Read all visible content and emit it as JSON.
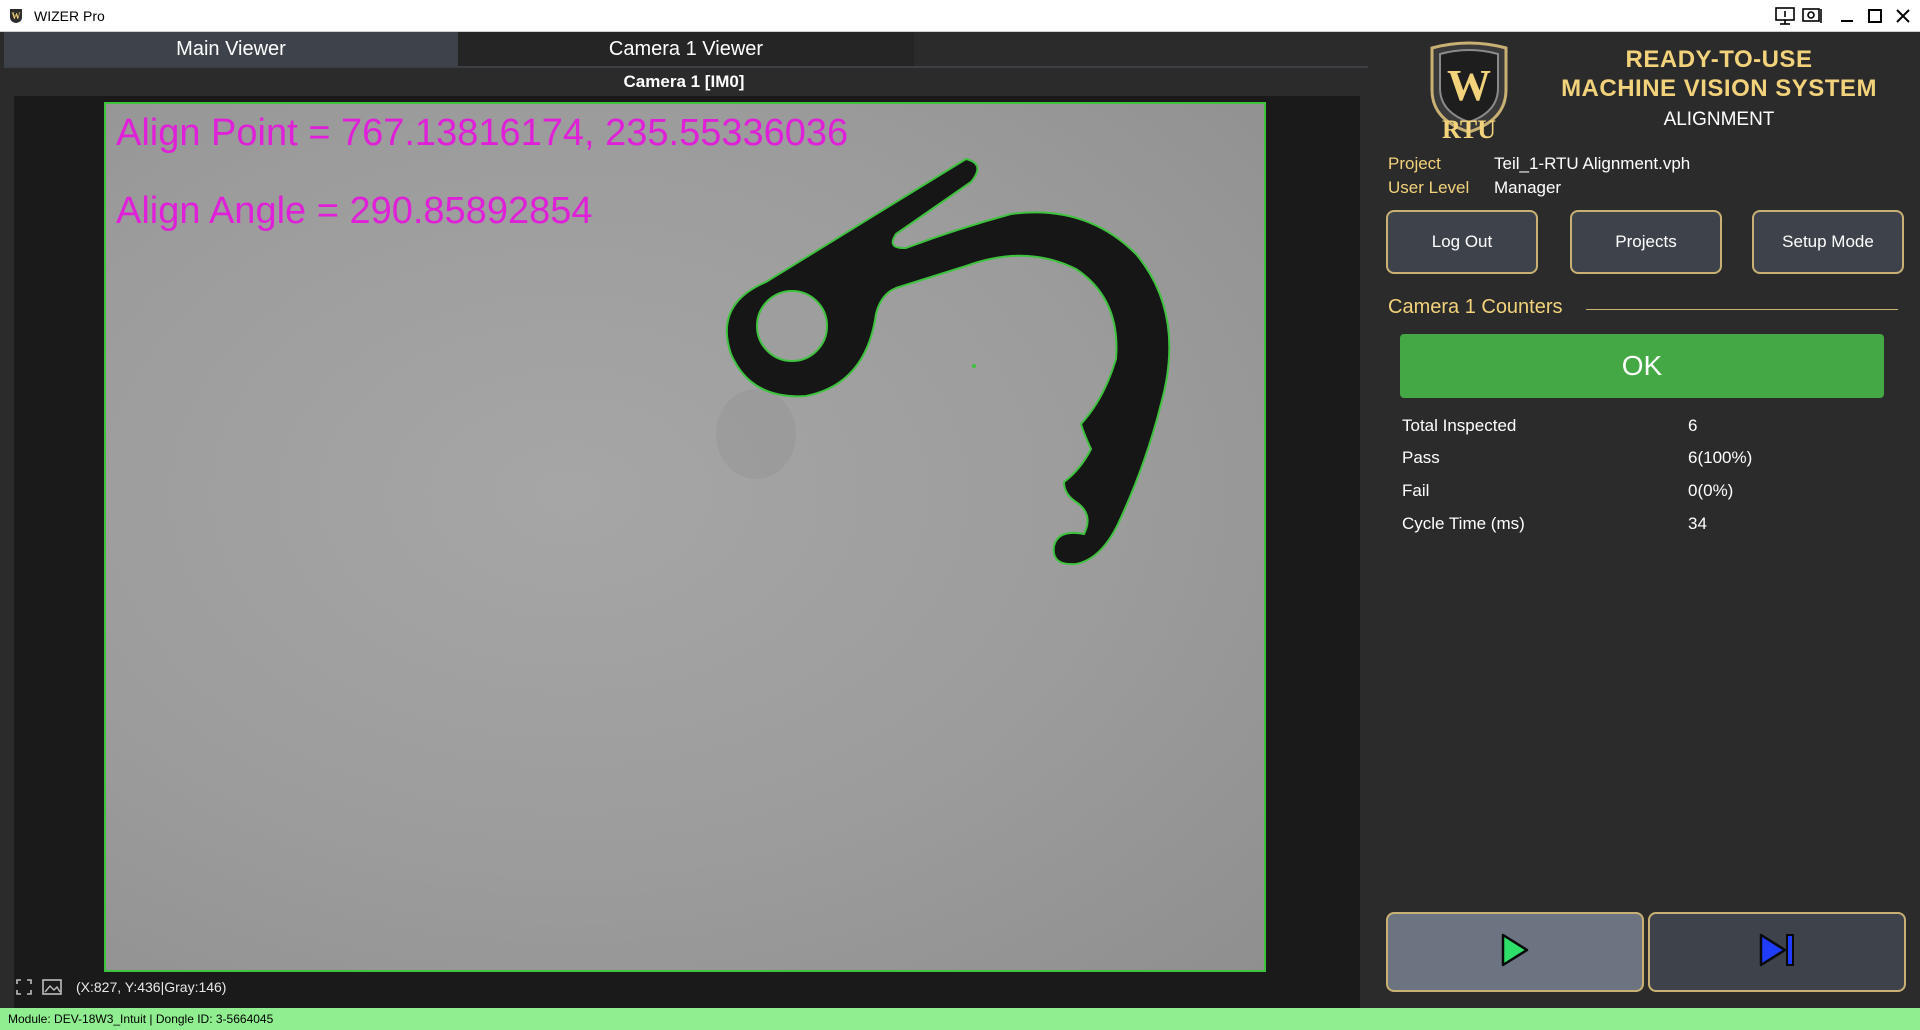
{
  "window": {
    "title": "WIZER Pro"
  },
  "tabs": [
    {
      "label": "Main Viewer"
    },
    {
      "label": "Camera 1 Viewer"
    }
  ],
  "viewer": {
    "title": "Camera 1  [IM0]",
    "align_point_text": "Align Point = 767.13816174, 235.55336036",
    "align_angle_text": "Align Angle = 290.85892854",
    "coordinates": "(X:827, Y:436|Gray:146)"
  },
  "brand": {
    "logo_letter": "W",
    "logo_text": "RTU",
    "line1": "READY-TO-USE",
    "line2": "MACHINE VISION SYSTEM",
    "subtitle": "ALIGNMENT"
  },
  "info": {
    "project_label": "Project",
    "project_value": "Teil_1-RTU Alignment.vph",
    "user_level_label": "User Level",
    "user_level_value": "Manager"
  },
  "buttons": {
    "logout": "Log Out",
    "projects": "Projects",
    "setup": "Setup Mode"
  },
  "counters": {
    "title": "Camera 1 Counters",
    "status": "OK",
    "rows": [
      {
        "label": "Total Inspected",
        "value": "6"
      },
      {
        "label": "Pass",
        "value": "6(100%)"
      },
      {
        "label": "Fail",
        "value": "0(0%)"
      },
      {
        "label": "Cycle Time (ms)",
        "value": "34"
      }
    ]
  },
  "status_bar": {
    "text": "Module: DEV-18W3_Intuit | Dongle ID: 3-5664045"
  },
  "colors": {
    "accent_gold": "#f2d27a",
    "ok_green": "#44a845",
    "overlay_magenta": "#e020d8",
    "contour_green": "#3ec33e",
    "status_bar_green": "#90ee90"
  }
}
